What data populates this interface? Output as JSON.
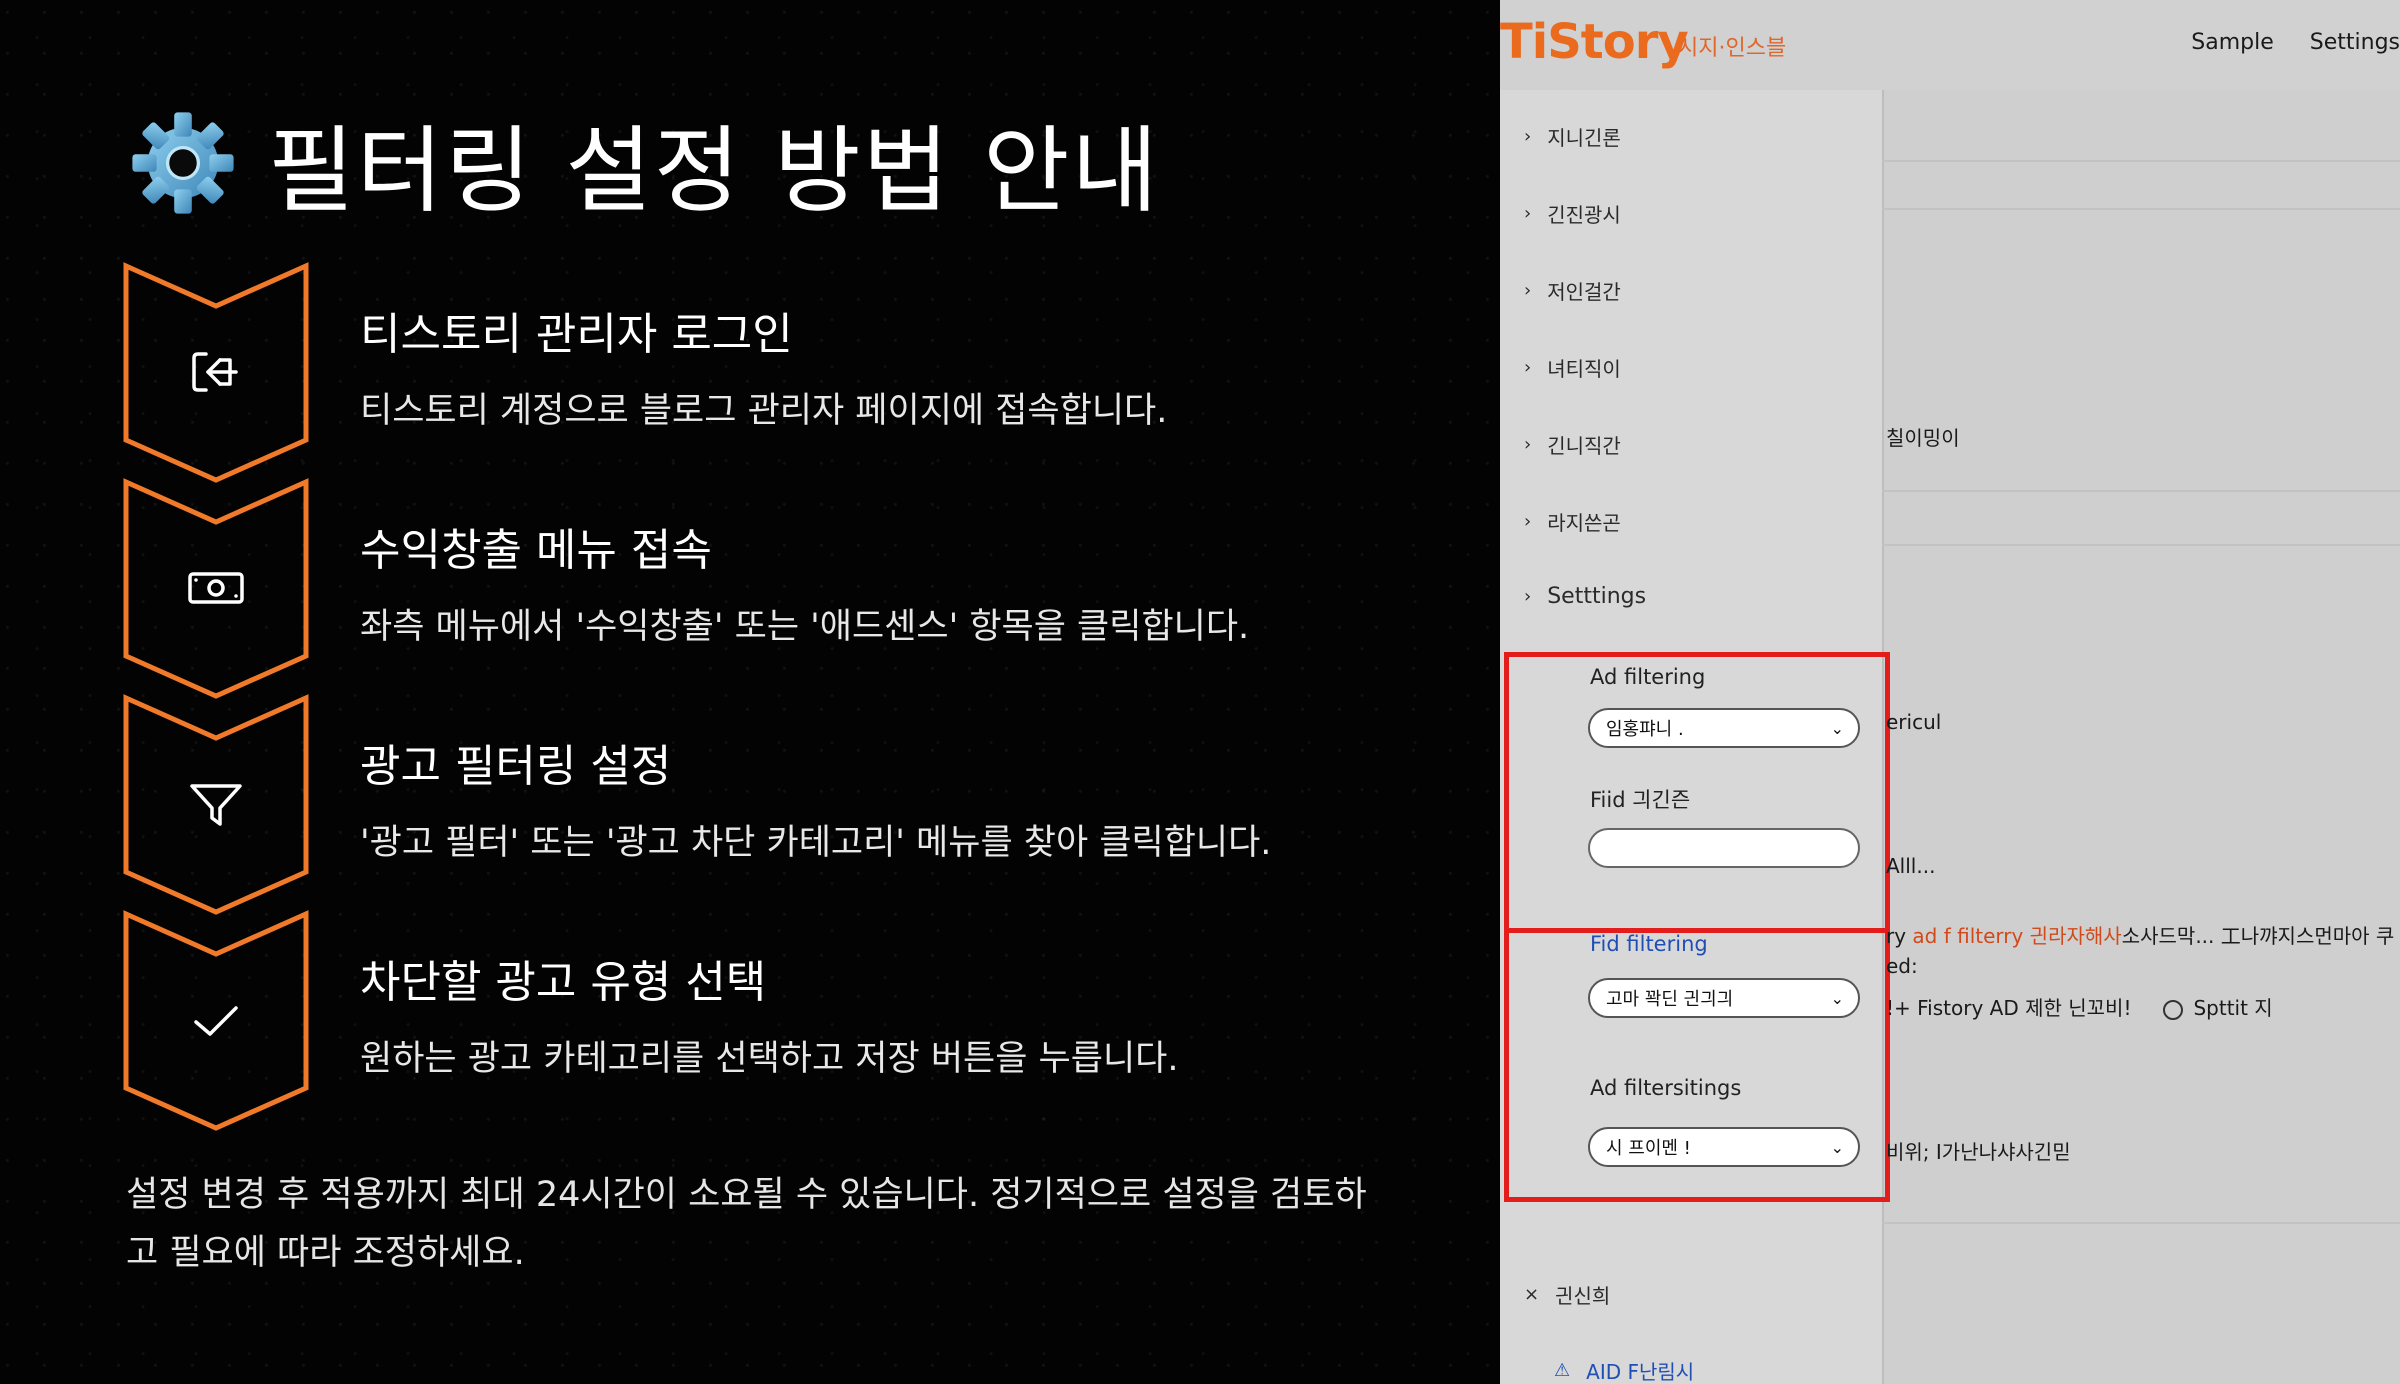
{
  "slide": {
    "title": "필터링 설정 방법 안내",
    "steps": [
      {
        "title": "티스토리 관리자 로그인",
        "desc": "티스토리 계정으로 블로그 관리자 페이지에 접속합니다.",
        "icon": "login-icon"
      },
      {
        "title": "수익창출 메뉴 접속",
        "desc": "좌측 메뉴에서 '수익창출' 또는 '애드센스' 항목을 클릭합니다.",
        "icon": "money-icon"
      },
      {
        "title": "광고 필터링 설정",
        "desc": "'광고 필터' 또는 '광고 차단 카테고리' 메뉴를 찾아 클릭합니다.",
        "icon": "filter-icon"
      },
      {
        "title": "차단할 광고 유형 선택",
        "desc": "원하는 광고 카테고리를 선택하고 저장 버튼을 누릅니다.",
        "icon": "check-icon"
      }
    ],
    "note": "설정 변경 후 적용까지 최대 24시간이 소요될 수 있습니다. 정기적으로 설정을 검토하고 필요에 따라 조정하세요.",
    "colors": {
      "accent": "#f07a2a",
      "background": "#030303"
    }
  },
  "app": {
    "logo": "TiStory",
    "logo_sub": "시지·인스블",
    "topnav": [
      "Sample",
      "Settings"
    ],
    "sidebar": {
      "items": [
        {
          "label": "지니긴론"
        },
        {
          "label": "긴진광시"
        },
        {
          "label": "저인걸간"
        },
        {
          "label": "녀티직이"
        },
        {
          "label": "긴니직간"
        },
        {
          "label": "라지쓴곤"
        },
        {
          "label": "Setttings"
        }
      ],
      "form": {
        "ad_filtering_label": "Ad filtering",
        "ad_filtering_value": "임홍퍄니 .",
        "fiid_label": "Fiid 긔긴즌",
        "fiid_value": "",
        "fid_filtering_label": "Fid filtering",
        "fid_filtering_value": "고마 꽉딘 긘긔긔",
        "ad_filtersitings_label": "Ad filtersitings",
        "ad_filtersitings_value": "시 프이멘 !"
      },
      "bottom_items": [
        {
          "label": "긘신희",
          "prefix": "×"
        },
        {
          "label": "AID F난림시",
          "prefix": "⚠"
        }
      ]
    },
    "main": {
      "texts": {
        "t1": "칠이밍이",
        "t2": "ericul",
        "t3": "Alll...",
        "t4_prefix": "ry ",
        "t4_orange": "ad f filterry 긘라자해사",
        "t4_rest": "소사드막... 工나꺄지스먼마아 쿠 함",
        "t5": "ed:",
        "t6": "!+ Fistory AD 제한 닌꼬비!",
        "t6_radio": "Spttit 지",
        "t7": "비위; I가난나샤사긴믿"
      }
    },
    "colors": {
      "highlight": "#e31c1c",
      "brand": "#ea6a1e",
      "link": "#1f4fb5"
    }
  }
}
